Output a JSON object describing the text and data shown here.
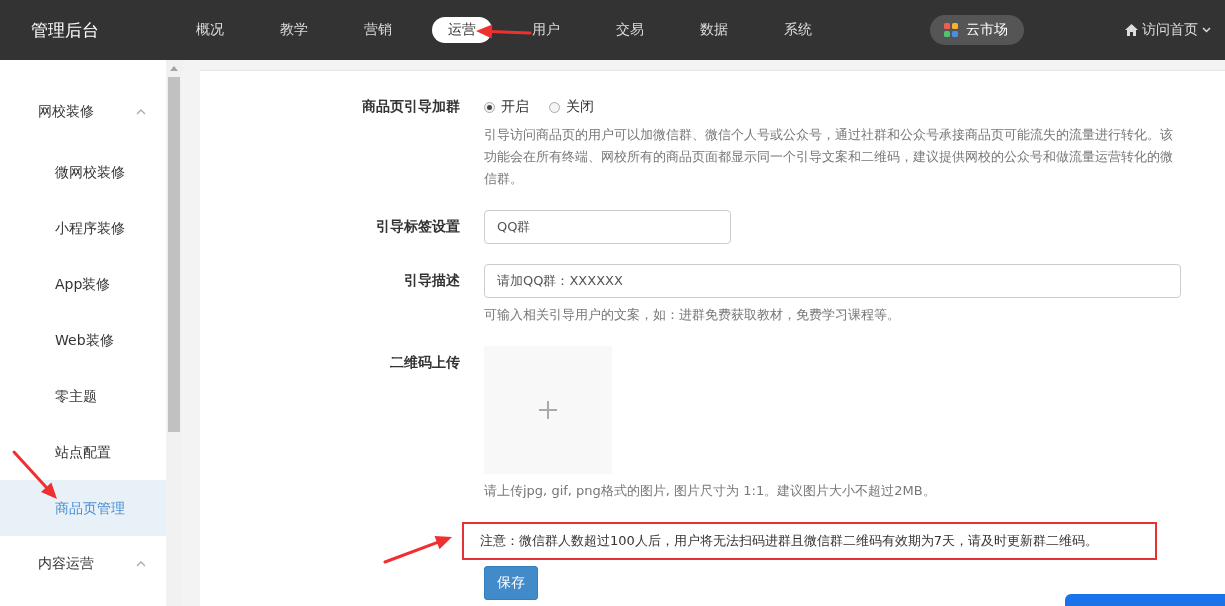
{
  "top_bar": {
    "title": "管理后台",
    "nav": [
      {
        "label": "概况",
        "selected": false
      },
      {
        "label": "教学",
        "selected": false
      },
      {
        "label": "营销",
        "selected": false
      },
      {
        "label": "运营",
        "selected": true
      },
      {
        "label": "用户",
        "selected": false
      },
      {
        "label": "交易",
        "selected": false
      },
      {
        "label": "数据",
        "selected": false
      },
      {
        "label": "系统",
        "selected": false
      }
    ],
    "market_button": "云市场",
    "home_link": "访问首页"
  },
  "sidebar": {
    "groups": [
      {
        "label": "网校装修",
        "expanded": true,
        "items": [
          {
            "label": "微网校装修",
            "selected": false
          },
          {
            "label": "小程序装修",
            "selected": false
          },
          {
            "label": "App装修",
            "selected": false
          },
          {
            "label": "Web装修",
            "selected": false
          },
          {
            "label": "零主题",
            "selected": false
          },
          {
            "label": "站点配置",
            "selected": false
          },
          {
            "label": "商品页管理",
            "selected": true
          }
        ]
      },
      {
        "label": "内容运营",
        "expanded": true
      }
    ]
  },
  "form": {
    "fields": [
      {
        "kind": "radio",
        "label": "商品页引导加群",
        "options": [
          {
            "label": "开启",
            "selected": true
          },
          {
            "label": "关闭",
            "selected": false
          }
        ],
        "help": "引导访问商品页的用户可以加微信群、微信个人号或公众号，通过社群和公众号承接商品页可能流失的流量进行转化。该功能会在所有终端、网校所有的商品页面都显示同一个引导文案和二维码，建议提供网校的公众号和做流量运营转化的微信群。"
      },
      {
        "kind": "text",
        "label": "引导标签设置",
        "value": "QQ群"
      },
      {
        "kind": "longtext",
        "label": "引导描述",
        "value": "请加QQ群：XXXXXX",
        "help": "可输入相关引导用户的文案，如：进群免费获取教材，免费学习课程等。"
      },
      {
        "kind": "upload",
        "label": "二维码上传",
        "help": "请上传jpg, gif, png格式的图片, 图片尺寸为 1:1。建议图片大小不超过2MB。"
      }
    ],
    "notice": "注意：微信群人数超过100人后，用户将无法扫码进群且微信群二维码有效期为7天，请及时更新群二维码。",
    "save_button": "保存"
  }
}
